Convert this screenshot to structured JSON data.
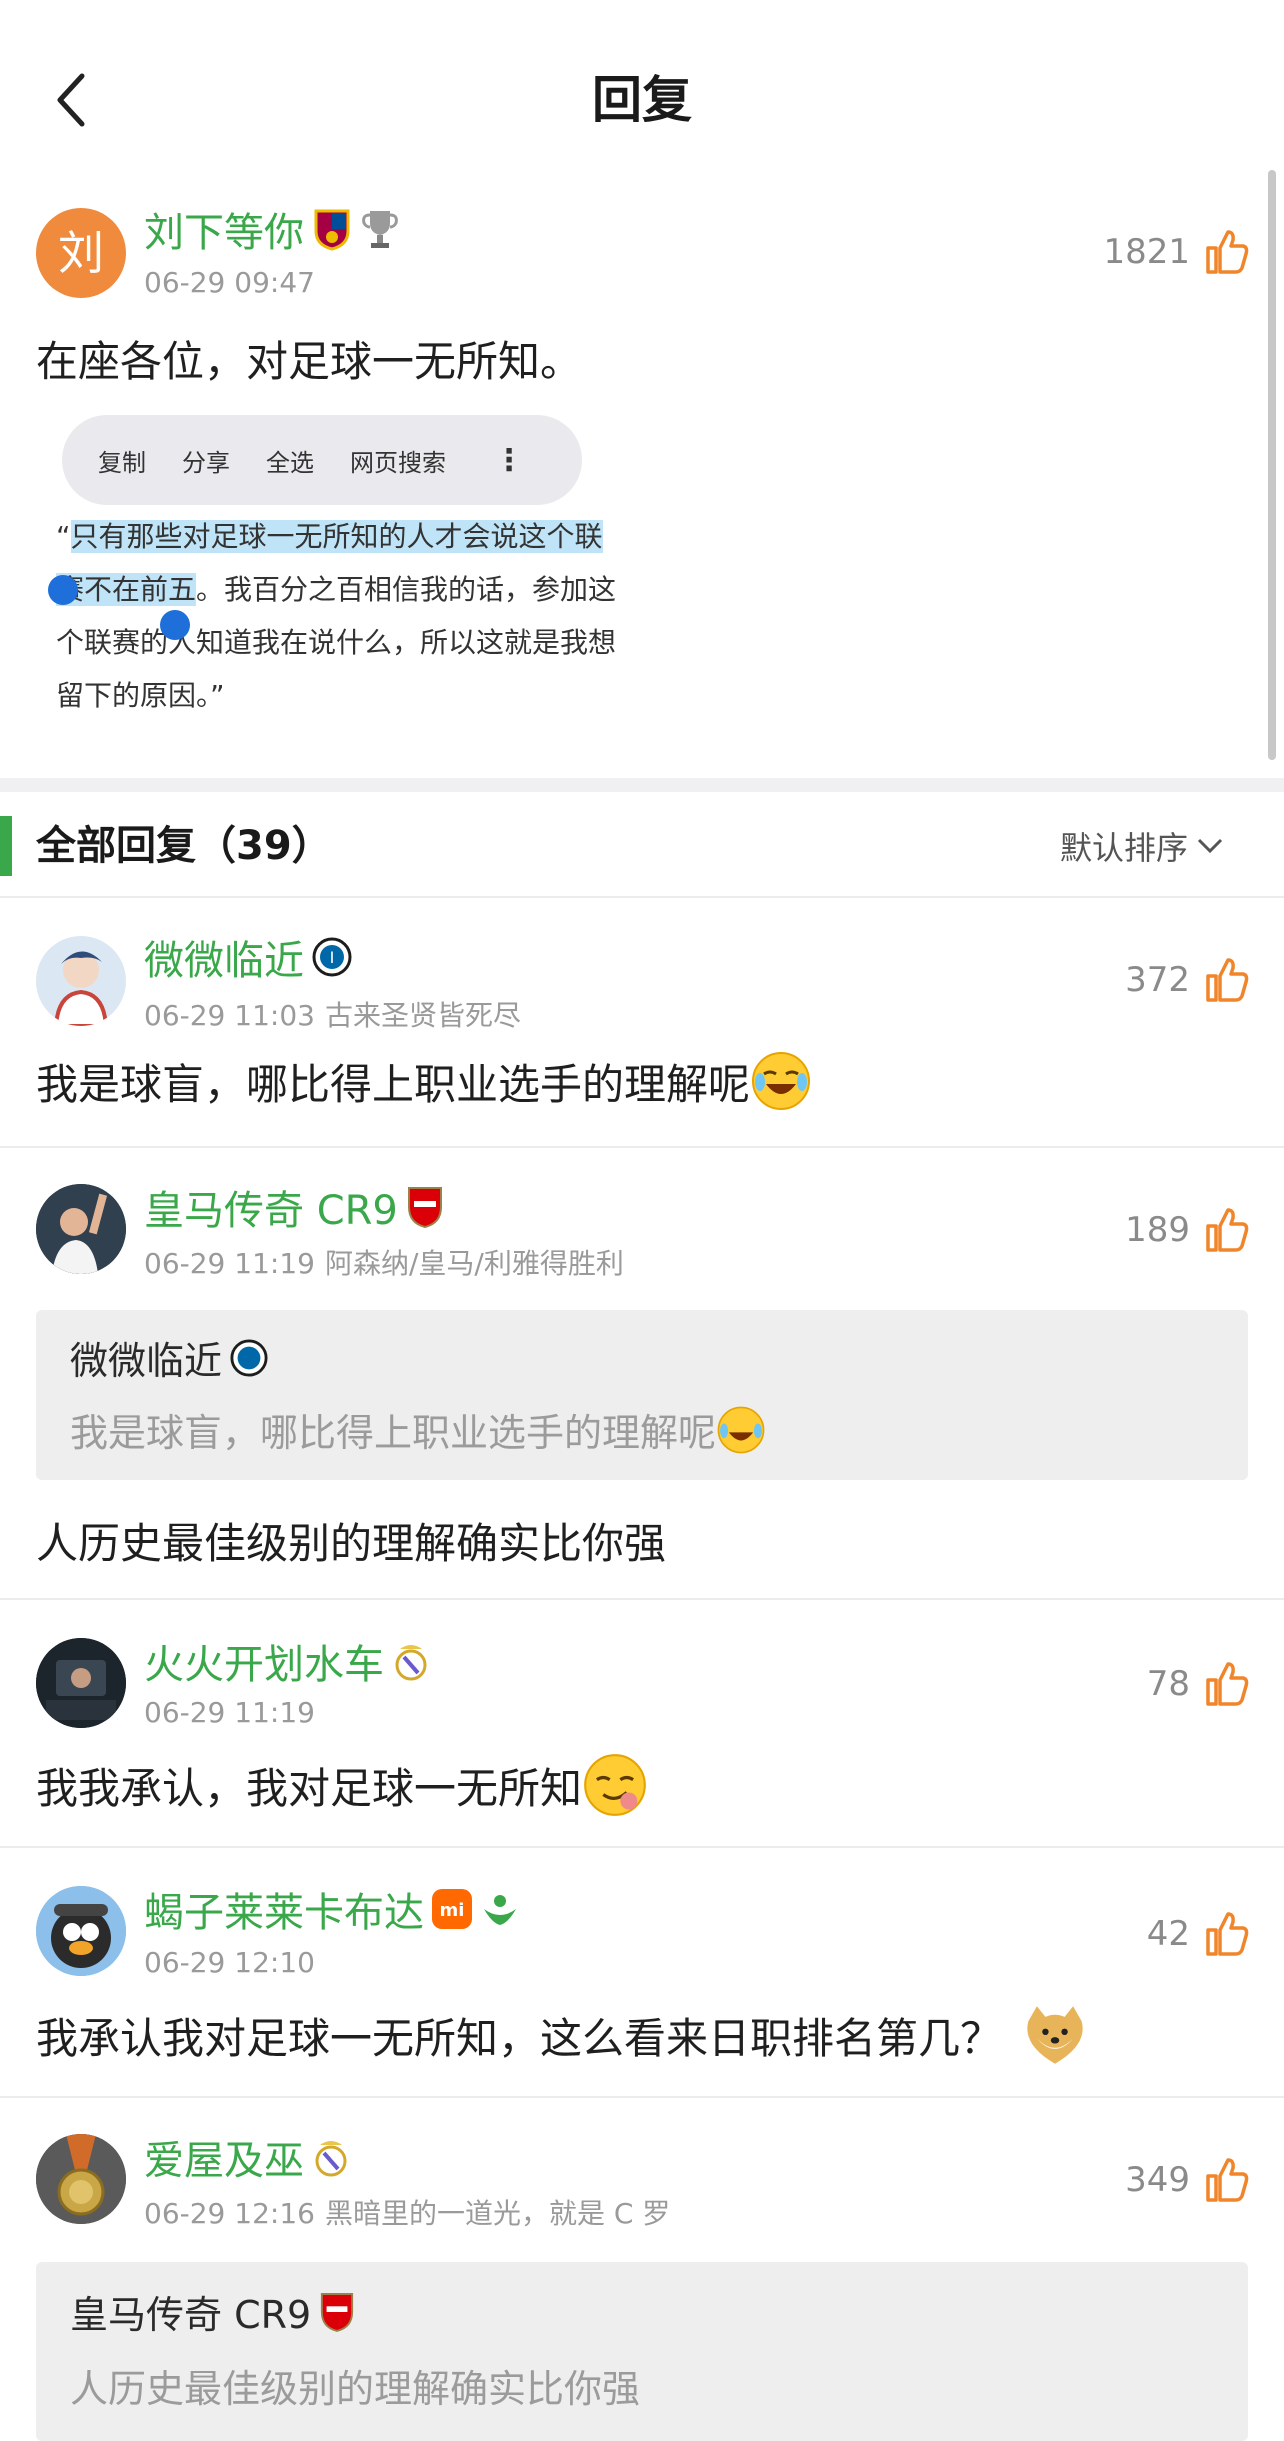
{
  "header": {
    "title": "回复"
  },
  "main_post": {
    "username": "刘下等你",
    "avatar_char": "刘",
    "timestamp": "06-29 09:47",
    "likes": "1821",
    "content": "在座各位，对足球一无所知。",
    "image": {
      "menu_items": [
        "复制",
        "分享",
        "全选",
        "网页搜索"
      ],
      "quote_line1_pre": "“",
      "quote_line1_hl": "只有那些对足球一无所知的人才会说这个联",
      "quote_line2_hl": "赛不在前五",
      "quote_line2_post": "。我百分之百相信我的话，参加这",
      "quote_line3": "个联赛的人知道我在说什么，所以这就是我想",
      "quote_line4": "留下的原因。”"
    }
  },
  "replies_section": {
    "title": "全部回复（39）",
    "sort_label": "默认排序"
  },
  "replies": [
    {
      "username": "微微临近",
      "timestamp": "06-29 11:03",
      "tag": "古来圣贤皆死尽",
      "likes": "372",
      "content": "我是球盲，哪比得上职业选手的理解呢"
    },
    {
      "username": "皇马传奇 CR9",
      "timestamp": "06-29 11:19",
      "tag": "阿森纳/皇马/利雅得胜利",
      "likes": "189",
      "quoted": {
        "username": "微微临近",
        "text": "我是球盲，哪比得上职业选手的理解呢"
      },
      "content": "人历史最佳级别的理解确实比你强"
    },
    {
      "username": "火火开划水车",
      "timestamp": "06-29 11:19",
      "tag": "",
      "likes": "78",
      "content": "我我承认，我对足球一无所知"
    },
    {
      "username": "蝎子莱莱卡布达",
      "timestamp": "06-29 12:10",
      "tag": "",
      "likes": "42",
      "content": "我承认我对足球一无所知，这么看来日职排名第几？"
    },
    {
      "username": "爱屋及巫",
      "timestamp": "06-29 12:16",
      "tag": "黑暗里的一道光，就是 C 罗",
      "likes": "349",
      "quoted": {
        "username": "皇马传奇 CR9",
        "text": "人历史最佳级别的理解确实比你强"
      }
    }
  ]
}
